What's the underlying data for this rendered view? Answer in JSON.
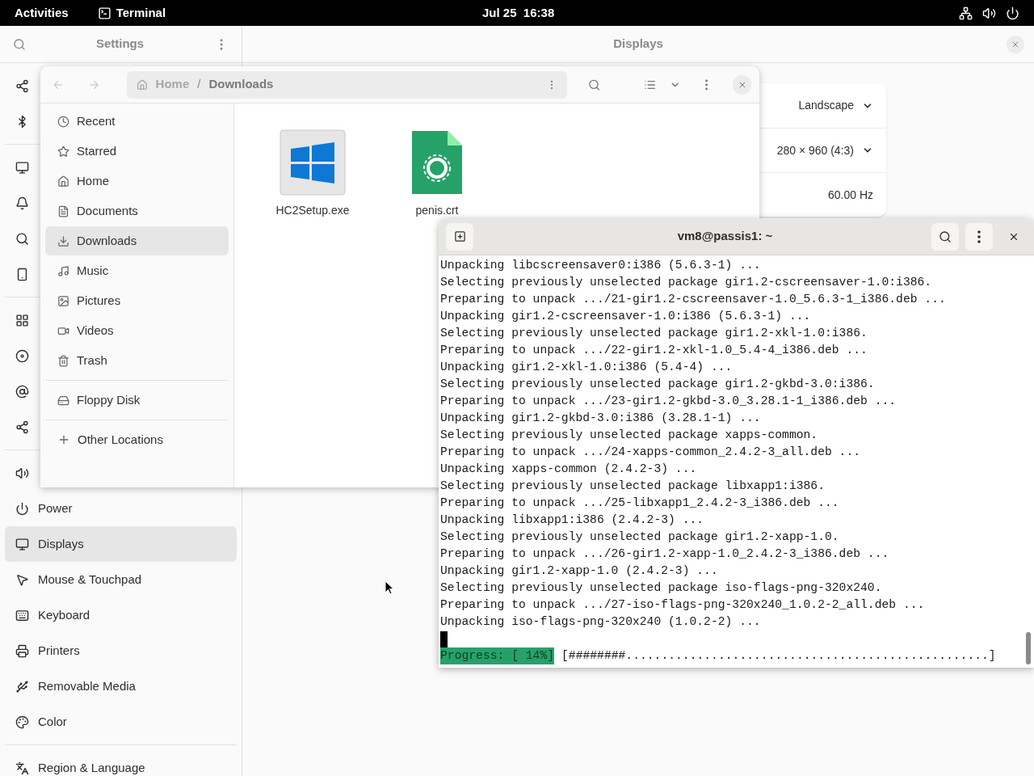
{
  "top_bar": {
    "activities": "Activities",
    "app_name": "Terminal",
    "clock": "Jul 25  16:38"
  },
  "settings": {
    "title": "Settings",
    "panel_title": "Displays",
    "sidebar": [
      [
        {
          "label": "Power",
          "selected": false
        },
        {
          "label": "Displays",
          "selected": true
        },
        {
          "label": "Mouse & Touchpad",
          "selected": false
        },
        {
          "label": "Keyboard",
          "selected": false
        },
        {
          "label": "Printers",
          "selected": false
        },
        {
          "label": "Removable Media",
          "selected": false
        },
        {
          "label": "Color",
          "selected": false
        }
      ],
      [
        {
          "label": "Region & Language",
          "selected": false
        }
      ]
    ],
    "display_options": [
      {
        "value": "Landscape",
        "kind": "dropdown"
      },
      {
        "value": "280 × 960 (4:3)",
        "kind": "dropdown"
      },
      {
        "value": "60.00 Hz",
        "kind": "value"
      }
    ]
  },
  "files": {
    "path": [
      "Home",
      "Downloads"
    ],
    "path_separator": "/",
    "places": [
      {
        "label": "Recent",
        "selected": false
      },
      {
        "label": "Starred",
        "selected": false
      },
      {
        "label": "Home",
        "selected": false
      },
      {
        "label": "Documents",
        "selected": false
      },
      {
        "label": "Downloads",
        "selected": true
      },
      {
        "label": "Music",
        "selected": false
      },
      {
        "label": "Pictures",
        "selected": false
      },
      {
        "label": "Videos",
        "selected": false
      },
      {
        "label": "Trash",
        "selected": false
      }
    ],
    "devices": [
      {
        "label": "Floppy Disk",
        "selected": false
      }
    ],
    "other_locations": "Other Locations",
    "items": [
      {
        "name": "HC2Setup.exe",
        "kind": "executable"
      },
      {
        "name": "penis.crt",
        "kind": "certificate"
      }
    ]
  },
  "terminal": {
    "title": "vm8@passis1: ~",
    "lines": [
      "Unpacking libcscreensaver0:i386 (5.6.3-1) ...",
      "Selecting previously unselected package gir1.2-cscreensaver-1.0:i386.",
      "Preparing to unpack .../21-gir1.2-cscreensaver-1.0_5.6.3-1_i386.deb ...",
      "Unpacking gir1.2-cscreensaver-1.0:i386 (5.6.3-1) ...",
      "Selecting previously unselected package gir1.2-xkl-1.0:i386.",
      "Preparing to unpack .../22-gir1.2-xkl-1.0_5.4-4_i386.deb ...",
      "Unpacking gir1.2-xkl-1.0:i386 (5.4-4) ...",
      "Selecting previously unselected package gir1.2-gkbd-3.0:i386.",
      "Preparing to unpack .../23-gir1.2-gkbd-3.0_3.28.1-1_i386.deb ...",
      "Unpacking gir1.2-gkbd-3.0:i386 (3.28.1-1) ...",
      "Selecting previously unselected package xapps-common.",
      "Preparing to unpack .../24-xapps-common_2.4.2-3_all.deb ...",
      "Unpacking xapps-common (2.4.2-3) ...",
      "Selecting previously unselected package libxapp1:i386.",
      "Preparing to unpack .../25-libxapp1_2.4.2-3_i386.deb ...",
      "Unpacking libxapp1:i386 (2.4.2-3) ...",
      "Selecting previously unselected package gir1.2-xapp-1.0.",
      "Preparing to unpack .../26-gir1.2-xapp-1.0_2.4.2-3_i386.deb ...",
      "Unpacking gir1.2-xapp-1.0 (2.4.2-3) ...",
      "Selecting previously unselected package iso-flags-png-320x240.",
      "Preparing to unpack .../27-iso-flags-png-320x240_1.0.2-2_all.deb ...",
      "Unpacking iso-flags-png-320x240 (1.0.2-2) ..."
    ],
    "progress_label": "Progress: [ 14%]",
    "progress_bar": "[########...................................................]"
  }
}
